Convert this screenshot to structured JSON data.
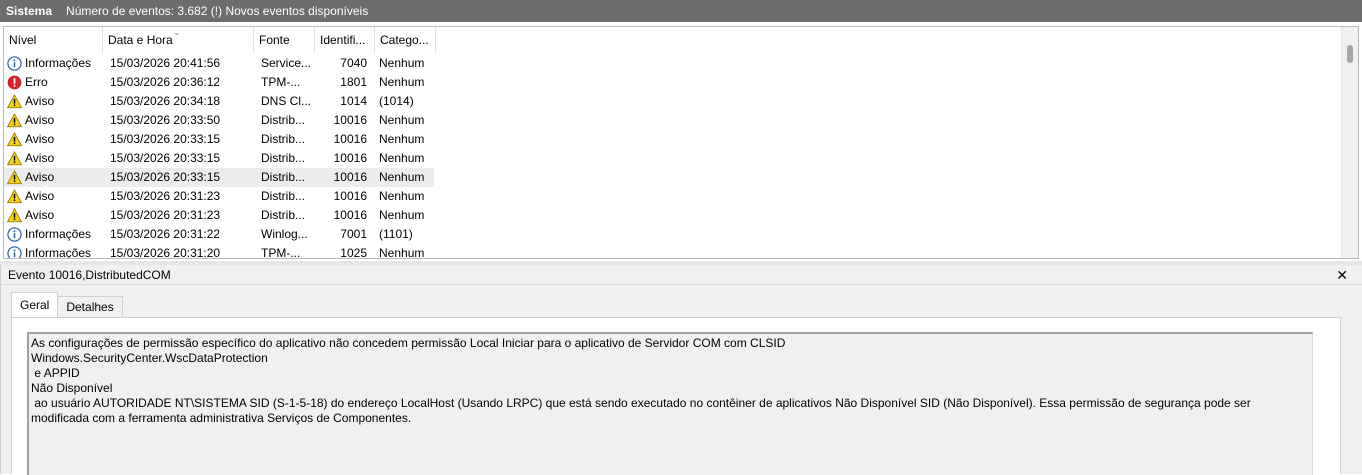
{
  "topbar": {
    "title": "Sistema",
    "status": "Número de eventos: 3.682 (!) Novos eventos disponíveis"
  },
  "columns": {
    "level": "Nível",
    "date": "Data e Hora",
    "source": "Fonte",
    "id": "Identifi...",
    "category": "Catego..."
  },
  "events": [
    {
      "level": "Informações",
      "icon": "info-icon",
      "date": "15/03/2026 20:41:56",
      "source": "Service...",
      "id": "7040",
      "category": "Nenhum"
    },
    {
      "level": "Erro",
      "icon": "error-icon",
      "date": "15/03/2026 20:36:12",
      "source": "TPM-...",
      "id": "1801",
      "category": "Nenhum"
    },
    {
      "level": "Aviso",
      "icon": "warning-icon",
      "date": "15/03/2026 20:34:18",
      "source": "DNS Cl...",
      "id": "1014",
      "category": "(1014)"
    },
    {
      "level": "Aviso",
      "icon": "warning-icon",
      "date": "15/03/2026 20:33:50",
      "source": "Distrib...",
      "id": "10016",
      "category": "Nenhum"
    },
    {
      "level": "Aviso",
      "icon": "warning-icon",
      "date": "15/03/2026 20:33:15",
      "source": "Distrib...",
      "id": "10016",
      "category": "Nenhum"
    },
    {
      "level": "Aviso",
      "icon": "warning-icon",
      "date": "15/03/2026 20:33:15",
      "source": "Distrib...",
      "id": "10016",
      "category": "Nenhum"
    },
    {
      "level": "Aviso",
      "icon": "warning-icon",
      "date": "15/03/2026 20:33:15",
      "source": "Distrib...",
      "id": "10016",
      "category": "Nenhum",
      "selected": true
    },
    {
      "level": "Aviso",
      "icon": "warning-icon",
      "date": "15/03/2026 20:31:23",
      "source": "Distrib...",
      "id": "10016",
      "category": "Nenhum"
    },
    {
      "level": "Aviso",
      "icon": "warning-icon",
      "date": "15/03/2026 20:31:23",
      "source": "Distrib...",
      "id": "10016",
      "category": "Nenhum"
    },
    {
      "level": "Informações",
      "icon": "info-icon",
      "date": "15/03/2026 20:31:22",
      "source": "Winlog...",
      "id": "7001",
      "category": "(1101)"
    },
    {
      "level": "Informações",
      "icon": "info-icon",
      "date": "15/03/2026 20:31:20",
      "source": "TPM-...",
      "id": "1025",
      "category": "Nenhum"
    }
  ],
  "detail": {
    "title": "Evento 10016,DistributedCOM",
    "close": "✕",
    "tabs": [
      "Geral",
      "Detalhes"
    ],
    "description": "As configurações de permissão específico do aplicativo não concedem permissão Local Iniciar para o aplicativo de Servidor COM com CLSID\nWindows.SecurityCenter.WscDataProtection\n e APPID\nNão Disponível\n ao usuário AUTORIDADE NT\\SISTEMA SID (S-1-5-18) do endereço LocalHost (Usando LRPC) que está sendo executado no contêiner de aplicativos Não Disponível SID (Não Disponível). Essa permissão de segurança pode ser modificada com a ferramenta administrativa Serviços de Componentes."
  },
  "colors": {
    "header_bg": "#6d6d6d",
    "selected_row": "#ececec",
    "panel_bg": "#f0f0f0"
  }
}
